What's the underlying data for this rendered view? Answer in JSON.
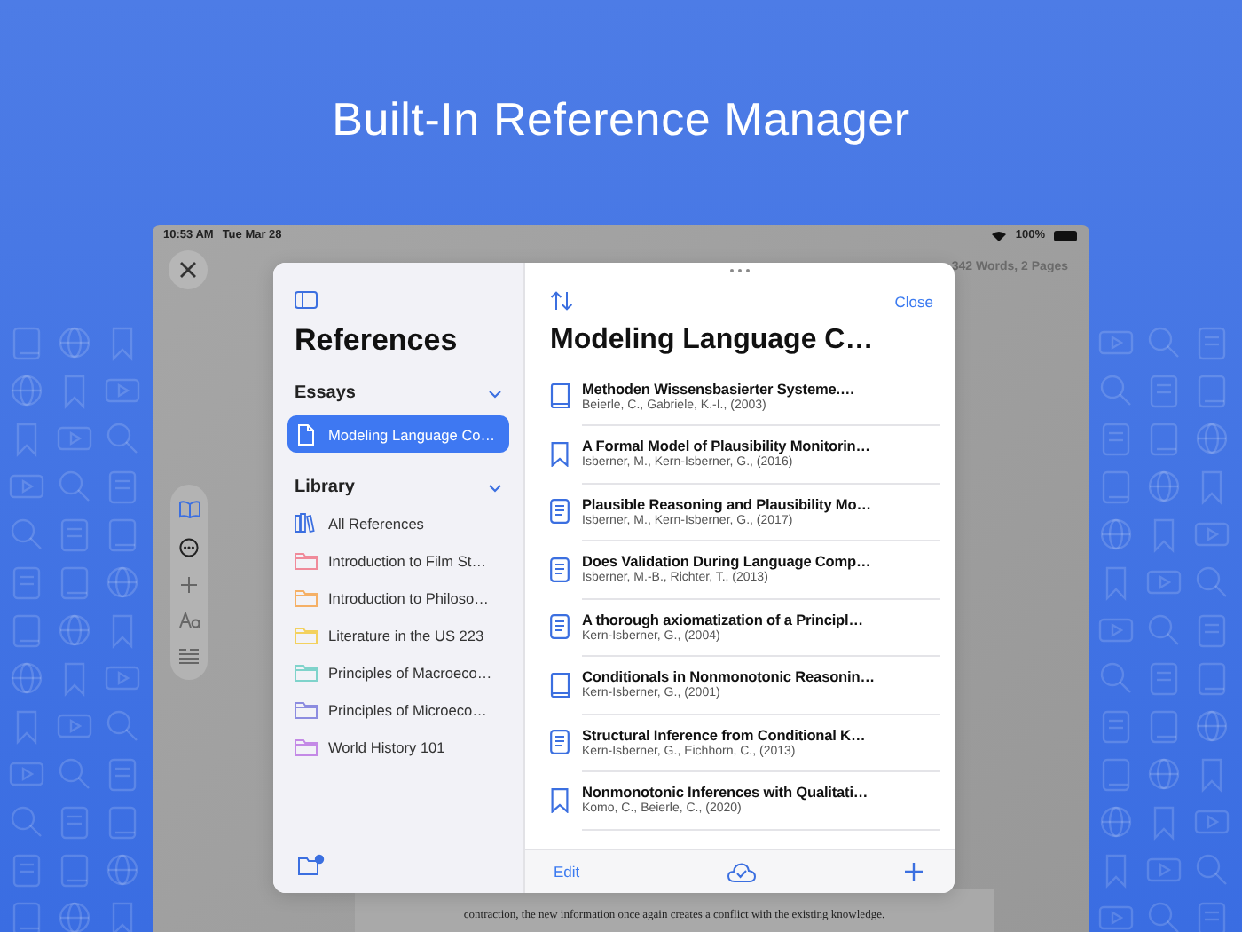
{
  "header": {
    "title": "Built-In Reference Manager"
  },
  "status_bar": {
    "time": "10:53 AM",
    "date": "Tue Mar 28",
    "battery": "100%"
  },
  "document": {
    "stats": "342 Words, 2 Pages",
    "text": "contraction, the new information once again creates a conflict with the existing knowledge."
  },
  "sidebar": {
    "title": "References",
    "sections": [
      {
        "title": "Essays",
        "expanded": true,
        "items": [
          {
            "label": "Modeling Language Co…",
            "kind": "document",
            "selected": true
          }
        ]
      },
      {
        "title": "Library",
        "expanded": true,
        "items": [
          {
            "label": "All References",
            "kind": "library",
            "selected": false
          },
          {
            "label": "Introduction to Film St…",
            "kind": "folder",
            "color": "#f08a9a",
            "selected": false
          },
          {
            "label": "Introduction to Philoso…",
            "kind": "folder",
            "color": "#f5b066",
            "selected": false
          },
          {
            "label": "Literature in the US 223",
            "kind": "folder",
            "color": "#f3d15e",
            "selected": false
          },
          {
            "label": "Principles of Macroeco…",
            "kind": "folder",
            "color": "#7fd3cb",
            "selected": false
          },
          {
            "label": "Principles of Microeco…",
            "kind": "folder",
            "color": "#8c8ce0",
            "selected": false
          },
          {
            "label": "World History 101",
            "kind": "folder",
            "color": "#c48ae6",
            "selected": false
          }
        ]
      }
    ]
  },
  "references": {
    "title": "Modeling Language C…",
    "close": "Close",
    "items": [
      {
        "kind": "book",
        "title": "Methoden Wissensbasierter Systeme.…",
        "authors": "Beierle, C., Gabriele, K.-I., (2003)"
      },
      {
        "kind": "bookmark",
        "title": "A Formal Model of Plausibility Monitorin…",
        "authors": "Isberner, M., Kern-Isberner, G., (2016)"
      },
      {
        "kind": "article",
        "title": "Plausible Reasoning and Plausibility Mo…",
        "authors": "Isberner, M., Kern-Isberner, G., (2017)"
      },
      {
        "kind": "article",
        "title": "Does Validation During Language Comp…",
        "authors": "Isberner, M.-B., Richter, T., (2013)"
      },
      {
        "kind": "article",
        "title": "A thorough axiomatization of a Principl…",
        "authors": "Kern-Isberner, G., (2004)"
      },
      {
        "kind": "book",
        "title": "Conditionals in Nonmonotonic Reasonin…",
        "authors": "Kern-Isberner, G., (2001)"
      },
      {
        "kind": "article",
        "title": "Structural Inference from Conditional K…",
        "authors": "Kern-Isberner, G., Eichhorn, C., (2013)"
      },
      {
        "kind": "bookmark",
        "title": "Nonmonotonic Inferences with Qualitati…",
        "authors": "Komo, C., Beierle, C., (2020)"
      }
    ]
  },
  "bottom_bar": {
    "edit": "Edit"
  }
}
